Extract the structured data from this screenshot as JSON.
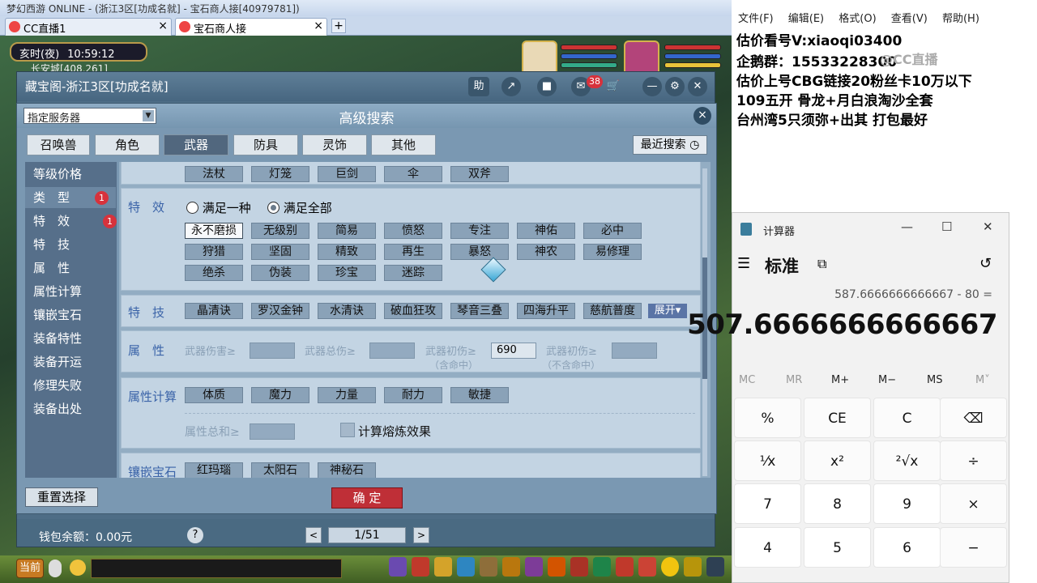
{
  "game_window": {
    "title": "梦幻西游 ONLINE - (浙江3区[功成名就] - 宝石商人接[40979781])",
    "tabs": [
      "CC直播1",
      "宝石商人接"
    ],
    "new_tab_symbol": "+",
    "clock": {
      "period": "亥时(夜)",
      "time": "10:59:12",
      "map": "长安城[408,261]"
    }
  },
  "cbg": {
    "title": "藏宝阁-浙江3区[功成名就]",
    "help_label": "助",
    "message_count": "38",
    "wallet": "钱包余额：0.00元",
    "help_q": "?",
    "page": "1/51",
    "prev": "<",
    "next": ">"
  },
  "dialog": {
    "title": "高级搜索",
    "server_select": "指定服务器",
    "close": "×",
    "categories": [
      "召唤兽",
      "角色",
      "武器",
      "防具",
      "灵饰",
      "其他"
    ],
    "active_category": "武器",
    "recent_search": "最近搜索",
    "sidebar": [
      {
        "label": "等级价格"
      },
      {
        "label": "类　型",
        "badge": "1"
      },
      {
        "label": "特　效",
        "badge": "1"
      },
      {
        "label": "特　技"
      },
      {
        "label": "属　性"
      },
      {
        "label": "属性计算"
      },
      {
        "label": "镶嵌宝石"
      },
      {
        "label": "装备特性"
      },
      {
        "label": "装备开运"
      },
      {
        "label": "修理失败"
      },
      {
        "label": "装备出处"
      }
    ],
    "weapon_types_partial": [
      "法杖",
      "灯笼",
      "巨剑",
      "伞",
      "双斧"
    ],
    "effects": {
      "label": "特　效",
      "radio_any": "满足一种",
      "radio_all": "满足全部",
      "options": [
        "永不磨损",
        "无级别",
        "简易",
        "愤怒",
        "专注",
        "神佑",
        "必中",
        "狩猎",
        "坚固",
        "精致",
        "再生",
        "暴怒",
        "神农",
        "易修理",
        "绝杀",
        "伪装",
        "珍宝",
        "迷踪"
      ],
      "selected": "永不磨损"
    },
    "skills": {
      "label": "特　技",
      "options": [
        "晶清诀",
        "罗汉金钟",
        "水清诀",
        "破血狂攻",
        "琴音三叠",
        "四海升平",
        "慈航普度"
      ],
      "expand": "展开"
    },
    "attributes": {
      "label": "属　性",
      "weapon_damage": "武器伤害≥",
      "weapon_total": "武器总伤≥",
      "init_damage_incl": "武器初伤≥",
      "init_damage_incl_value": "690",
      "init_damage_incl_note": "（含命中）",
      "init_damage_excl": "武器初伤≥",
      "init_damage_excl_note": "（不含命中）"
    },
    "attr_calc": {
      "label": "属性计算",
      "options": [
        "体质",
        "魔力",
        "力量",
        "耐力",
        "敏捷"
      ],
      "sum_label": "属性总和≥",
      "refine_label": "计算熔炼效果"
    },
    "gems": {
      "label": "镶嵌宝石",
      "options": [
        "红玛瑙",
        "太阳石",
        "神秘石"
      ]
    },
    "reset": "重置选择",
    "confirm": "确 定"
  },
  "taskbar": {
    "current": "当前"
  },
  "notepad": {
    "menu": [
      "文件(F)",
      "编辑(E)",
      "格式(O)",
      "查看(V)",
      "帮助(H)"
    ],
    "lines": [
      "估价看号V:xiaoqi03400",
      "企鹅群：15533228300",
      "估价上号CBG链接20粉丝卡10万以下",
      "109五开 骨龙+月白浪淘沙全套",
      "台州湾5只须弥+出其 打包最好"
    ],
    "watermark": "@CC直播"
  },
  "calculator": {
    "title": "计算器",
    "mode": "标准",
    "expression": "587.6666666666667 - 80 =",
    "result": "507.6666666666667",
    "memory": [
      "MC",
      "MR",
      "M+",
      "M−",
      "MS",
      "M˅"
    ],
    "keys": [
      [
        "%",
        "CE",
        "C",
        "⌫"
      ],
      [
        "¹⁄x",
        "x²",
        "²√x",
        "÷"
      ],
      [
        "7",
        "8",
        "9",
        "×"
      ],
      [
        "4",
        "5",
        "6",
        "−"
      ]
    ],
    "minimize": "—",
    "maximize": "☐",
    "close": "✕"
  },
  "colors": {
    "accent_red": "#bf2f37",
    "panel": "#c3d4e3",
    "header": "#4e6d86"
  }
}
